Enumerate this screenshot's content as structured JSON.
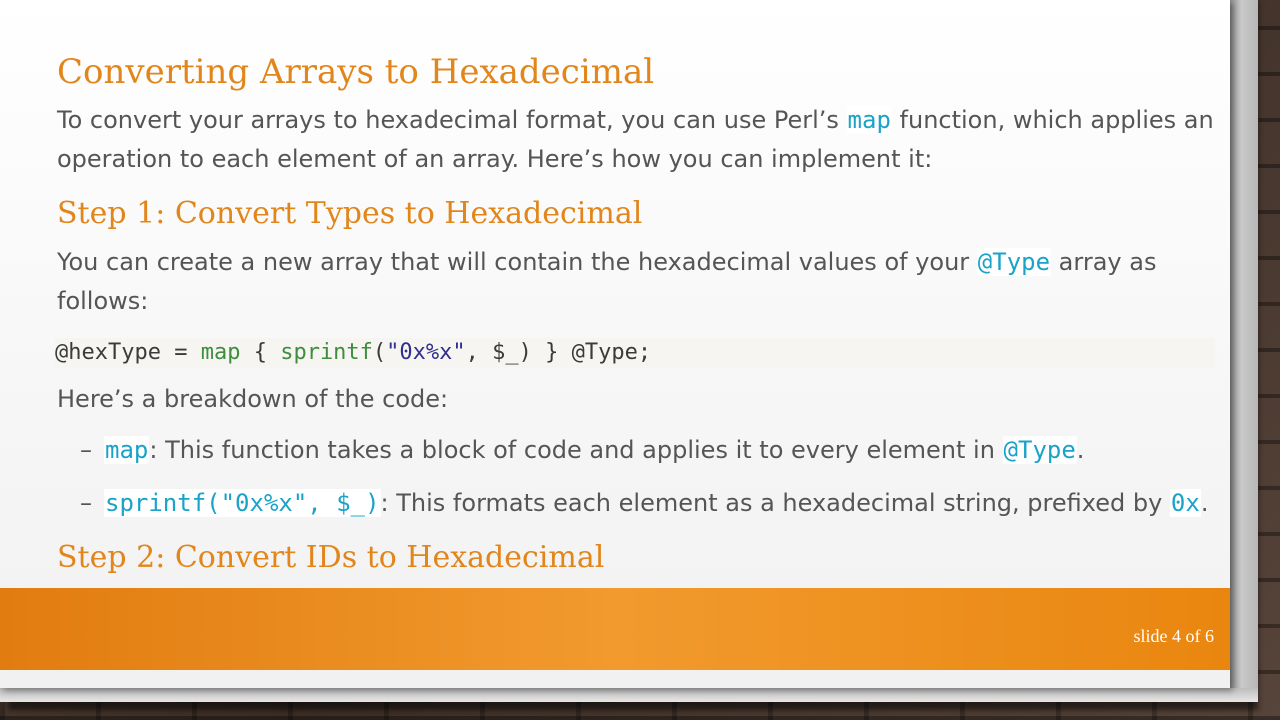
{
  "slide": {
    "title": "Converting Arrays to Hexadecimal",
    "intro": {
      "text_a": "To convert your arrays to hexadecimal format, you can use Perl’s ",
      "code_map": "map",
      "text_b": " function, which applies an operation to each element of an array. Here’s how you can implement it:"
    },
    "step1": {
      "heading": "Step 1: Convert Types to Hexadecimal",
      "text_a": "You can create a new array that will contain the hexadecimal values of your ",
      "code_type": "@Type",
      "text_b": " array as follows:"
    },
    "code_line": {
      "var": "@hexType = ",
      "map": "map",
      "open": " { ",
      "sprintf": "sprintf",
      "paren_open": "(",
      "str": "\"0x%x\"",
      "rest": ", $_) } @Type;"
    },
    "breakdown_intro": "Here’s a breakdown of the code:",
    "bullets": [
      {
        "dash": "–",
        "code": "map",
        "text_a": ": This function takes a block of code and applies it to every element in ",
        "code_b": "@Type",
        "text_b": "."
      },
      {
        "dash": "–",
        "code": "sprintf(\"0x%x\", $_)",
        "text_a": ": This formats each element as a hexadecimal string, prefixed by ",
        "code_b": "0x",
        "text_b": "."
      }
    ],
    "step2": {
      "heading": "Step 2: Convert IDs to Hexadecimal"
    },
    "footer": {
      "slide_number": "slide 4 of 6"
    }
  },
  "colors": {
    "heading": "#e2861b",
    "body_text": "#555555",
    "code_accent": "#19a3c9",
    "footer_bar": "#ee8c1c"
  }
}
